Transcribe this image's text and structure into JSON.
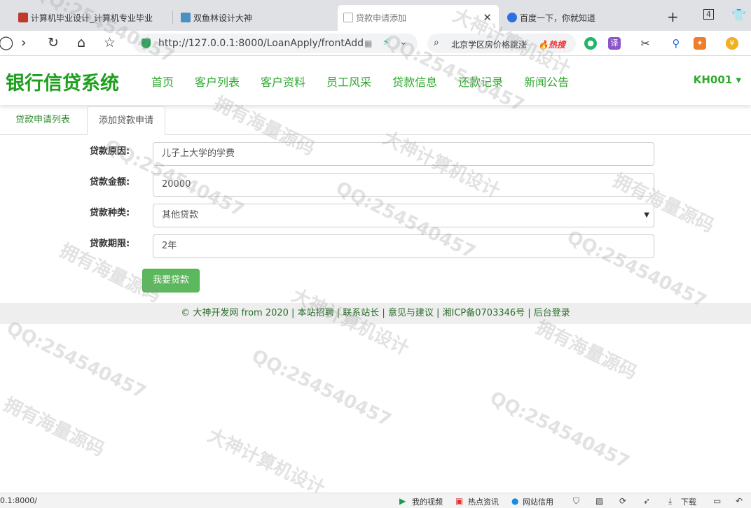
{
  "browser": {
    "tabs": [
      {
        "title": "计算机毕业设计_计算机专业毕业",
        "favicon_color": "#c0392b"
      },
      {
        "title": "双鱼林设计大神",
        "favicon_color": "#4a90c2"
      },
      {
        "title": "贷款申请添加",
        "favicon_color": "#bbbbbb"
      },
      {
        "title": "百度一下，你就知道",
        "favicon_color": "#2d6fe0"
      }
    ],
    "new_tab": "+",
    "tab_count": "4",
    "url": "http://127.0.0.1:8000/LoanApply/frontAdd",
    "search_query": "北京学区房价格跳涨",
    "search_hot": "🔥热搜"
  },
  "site": {
    "brand": "银行信贷系统",
    "menu": [
      "首页",
      "客户列表",
      "客户资料",
      "员工风采",
      "贷款信息",
      "还款记录",
      "新闻公告"
    ],
    "user": "KH001 ▾",
    "accent": "#2eaa2e"
  },
  "tabs": {
    "list": "贷款申请列表",
    "add": "添加贷款申请"
  },
  "form": {
    "reason_label": "贷款原因:",
    "reason_value": "儿子上大学的学费",
    "amount_label": "贷款金额:",
    "amount_value": "20000",
    "type_label": "贷款种类:",
    "type_value": "其他贷款",
    "term_label": "贷款期限:",
    "term_value": "2年",
    "submit_label": "我要贷款"
  },
  "footer": {
    "text": "© 大神开发网 from 2020 | 本站招聘 | 联系站长 | 意见与建议 | 湘ICP备0703346号 | 后台登录"
  },
  "statusbar": {
    "url": "0.1:8000/",
    "my_video": "我的视频",
    "hot_news": "热点资讯",
    "credit": "网站信用",
    "download": "下载"
  },
  "watermark": {
    "qq": "QQ:254540457",
    "god": "大神计算机设计",
    "source": "拥有海量源码"
  }
}
